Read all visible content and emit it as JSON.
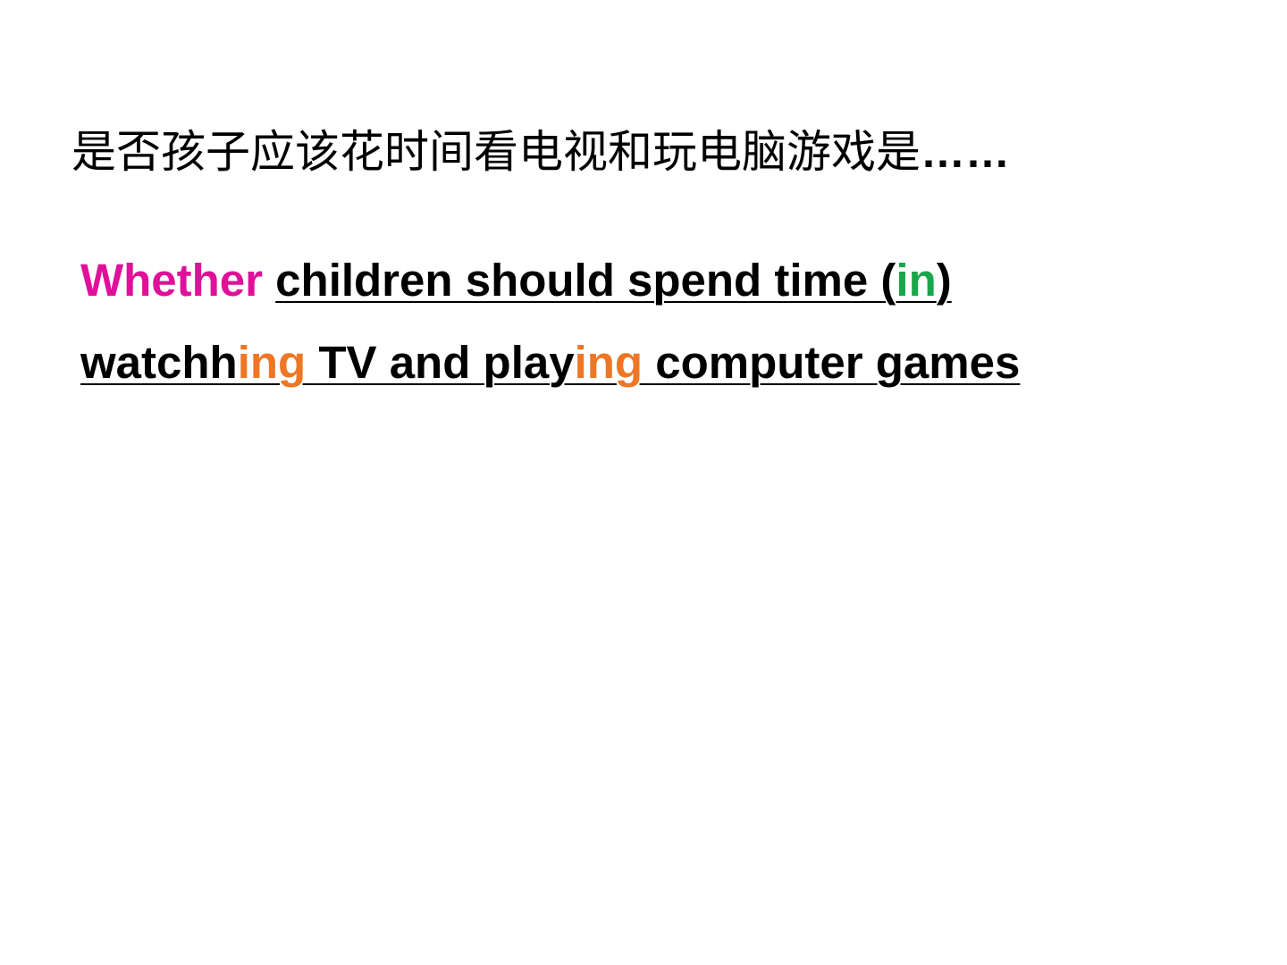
{
  "heading": {
    "chinese_text": "是否孩子应该花时间看电视和玩电脑游戏是",
    "ellipsis": "……"
  },
  "sentence": {
    "line1": {
      "word_whether": "Whether",
      "part_main": "children should spend time (",
      "word_in": "in",
      "close_paren": ")"
    },
    "line2": {
      "watch_stem": "watch",
      "h_letter": "h",
      "ing_suffix_1": "ing ",
      "middle": "TV and play",
      "ing_suffix_2": "ing ",
      "ending": "computer games"
    },
    "colors": {
      "whether": "#e0109a",
      "in": "#1aa64a",
      "ing": "#ee7624",
      "text": "#000000"
    }
  }
}
